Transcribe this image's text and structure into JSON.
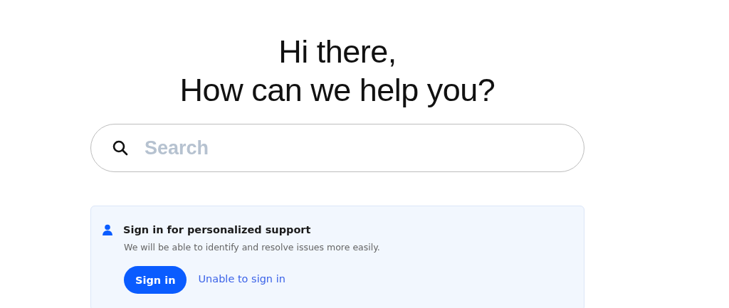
{
  "heading": [
    "Hi there,",
    "How can we help you?"
  ],
  "search": {
    "placeholder": "Search"
  },
  "signin_card": {
    "title": "Sign in for personalized support",
    "description": "We will be able to identify and resolve issues more easily.",
    "button": "Sign in",
    "link": "Unable to sign in"
  }
}
